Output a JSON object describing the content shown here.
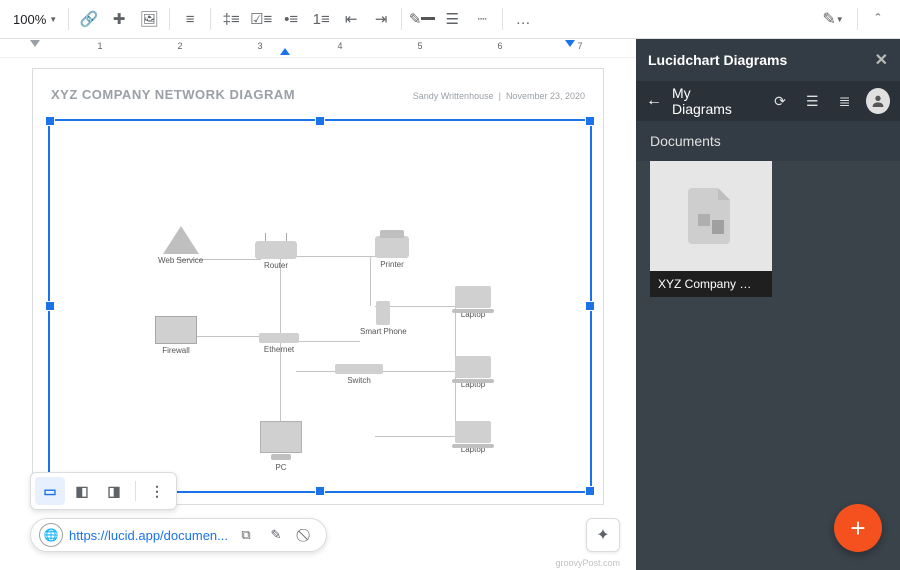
{
  "toolbar": {
    "zoom": "100%",
    "more": "…"
  },
  "document": {
    "title": "XYZ COMPANY NETWORK DIAGRAM",
    "author": "Sandy Writtenhouse",
    "date": "November 23, 2020"
  },
  "diagram": {
    "nodes": {
      "web_service": "Web Service",
      "firewall": "Firewall",
      "router": "Router",
      "ethernet": "Ethernet",
      "switch": "Switch",
      "printer": "Printer",
      "smart_phone": "Smart Phone",
      "laptop1": "Laptop",
      "laptop2": "Laptop",
      "laptop3": "Laptop",
      "pc": "PC"
    }
  },
  "link": {
    "url": "https://lucid.app/documen..."
  },
  "sidebar": {
    "title": "Lucidchart Diagrams",
    "breadcrumb": "My Diagrams",
    "section": "Documents",
    "thumb_caption": "XYZ Company …"
  },
  "ruler": {
    "marks": [
      "1",
      "2",
      "3",
      "4",
      "5",
      "6",
      "7"
    ]
  },
  "watermark": "groovyPost.com"
}
